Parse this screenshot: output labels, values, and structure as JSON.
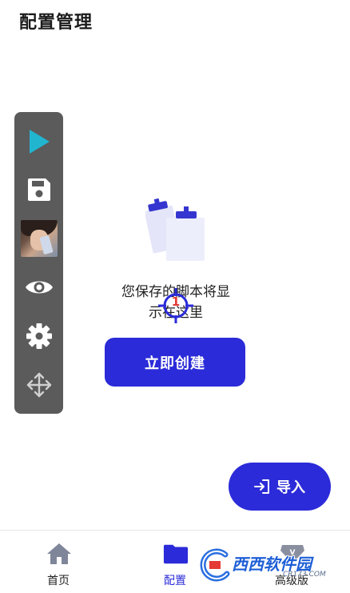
{
  "header": {
    "title": "配置管理"
  },
  "toolbar": {
    "items": [
      {
        "icon": "play-icon",
        "color": "#21b5d0"
      },
      {
        "icon": "save-icon"
      },
      {
        "icon": "avatar"
      },
      {
        "icon": "eye-icon"
      },
      {
        "icon": "gear-icon"
      },
      {
        "icon": "move-icon"
      }
    ]
  },
  "empty_state": {
    "line1": "您保存的脚本将显",
    "line2": "示在这里",
    "create_label": "立即创建"
  },
  "marker": {
    "number": "1"
  },
  "import_button": {
    "label": "导入"
  },
  "bottom_nav": {
    "items": [
      {
        "label": "首页",
        "icon": "home-icon",
        "active": false
      },
      {
        "label": "配置",
        "icon": "folder-icon",
        "active": true
      },
      {
        "label": "高级版",
        "icon": "vip-icon",
        "active": false
      }
    ]
  },
  "watermark": {
    "text": "西西软件园",
    "sub": "CR173.COM"
  },
  "colors": {
    "primary": "#2b2bd9",
    "toolbar_bg": "#5b5b5b",
    "play": "#21b5d0"
  }
}
